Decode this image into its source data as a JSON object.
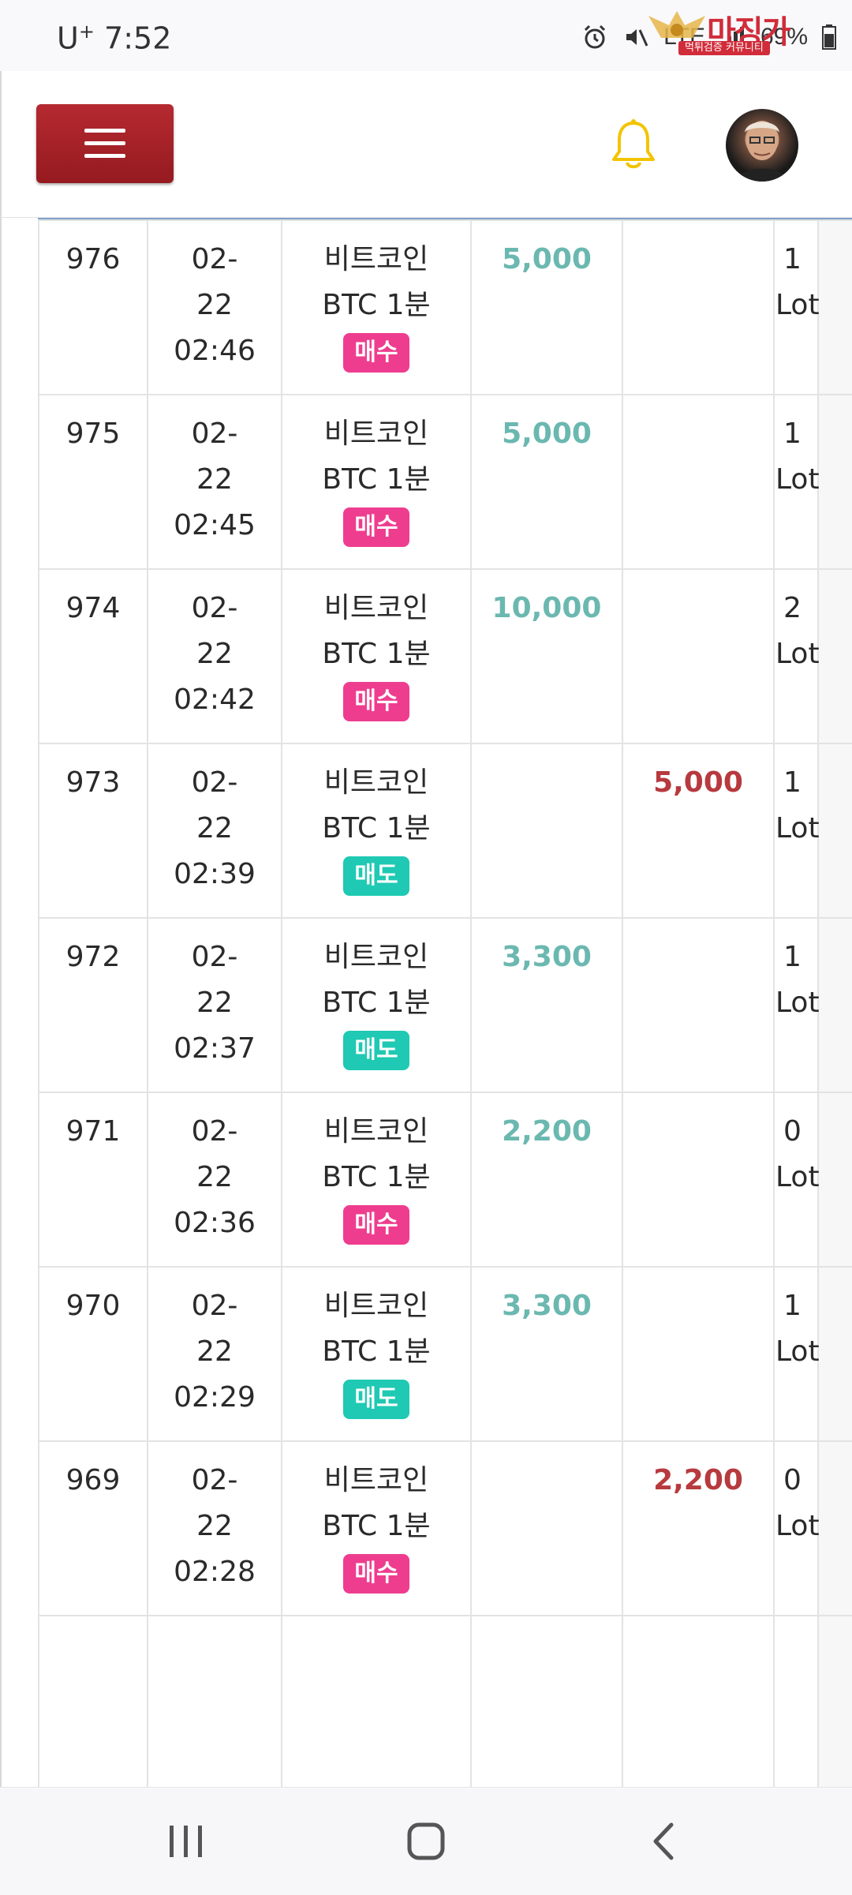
{
  "status_bar": {
    "carrier": "U",
    "carrier_sup": "+",
    "time": "7:52",
    "network": "LTE",
    "battery": "69%"
  },
  "watermark": {
    "brand": "마징가",
    "tagline": "먹튀검증 커뮤니티"
  },
  "header": {
    "menu_icon": "hamburger-icon",
    "bell_icon": "bell-icon",
    "bell_color": "#f2c400",
    "menu_color": "#a52228"
  },
  "trades": [
    {
      "no": "976",
      "date": "02-",
      "date2": "22",
      "time": "02:46",
      "product": "비트코인",
      "product2": "BTC 1분",
      "side": "매수",
      "side_type": "bid",
      "buy": "5,000",
      "sell": "",
      "qty": "1",
      "unit": "Lot"
    },
    {
      "no": "975",
      "date": "02-",
      "date2": "22",
      "time": "02:45",
      "product": "비트코인",
      "product2": "BTC 1분",
      "side": "매수",
      "side_type": "bid",
      "buy": "5,000",
      "sell": "",
      "qty": "1",
      "unit": "Lot"
    },
    {
      "no": "974",
      "date": "02-",
      "date2": "22",
      "time": "02:42",
      "product": "비트코인",
      "product2": "BTC 1분",
      "side": "매수",
      "side_type": "bid",
      "buy": "10,000",
      "sell": "",
      "qty": "2",
      "unit": "Lot"
    },
    {
      "no": "973",
      "date": "02-",
      "date2": "22",
      "time": "02:39",
      "product": "비트코인",
      "product2": "BTC 1분",
      "side": "매도",
      "side_type": "ask",
      "buy": "",
      "sell": "5,000",
      "qty": "1",
      "unit": "Lot"
    },
    {
      "no": "972",
      "date": "02-",
      "date2": "22",
      "time": "02:37",
      "product": "비트코인",
      "product2": "BTC 1분",
      "side": "매도",
      "side_type": "ask",
      "buy": "3,300",
      "sell": "",
      "qty": "1",
      "unit": "Lot"
    },
    {
      "no": "971",
      "date": "02-",
      "date2": "22",
      "time": "02:36",
      "product": "비트코인",
      "product2": "BTC 1분",
      "side": "매수",
      "side_type": "bid",
      "buy": "2,200",
      "sell": "",
      "qty": "0",
      "unit": "Lot"
    },
    {
      "no": "970",
      "date": "02-",
      "date2": "22",
      "time": "02:29",
      "product": "비트코인",
      "product2": "BTC 1분",
      "side": "매도",
      "side_type": "ask",
      "buy": "3,300",
      "sell": "",
      "qty": "1",
      "unit": "Lot"
    },
    {
      "no": "969",
      "date": "02-",
      "date2": "22",
      "time": "02:28",
      "product": "비트코인",
      "product2": "BTC 1분",
      "side": "매수",
      "side_type": "bid",
      "buy": "",
      "sell": "2,200",
      "qty": "0",
      "unit": "Lot"
    }
  ],
  "colors": {
    "buy_amount": "#6bb8b0",
    "sell_amount": "#b73a3e",
    "bid_badge": "#ee3d8f",
    "ask_badge": "#1fc9b3"
  },
  "nav_bar": {
    "recent": "recent-apps-icon",
    "home": "home-icon",
    "back": "back-icon"
  }
}
